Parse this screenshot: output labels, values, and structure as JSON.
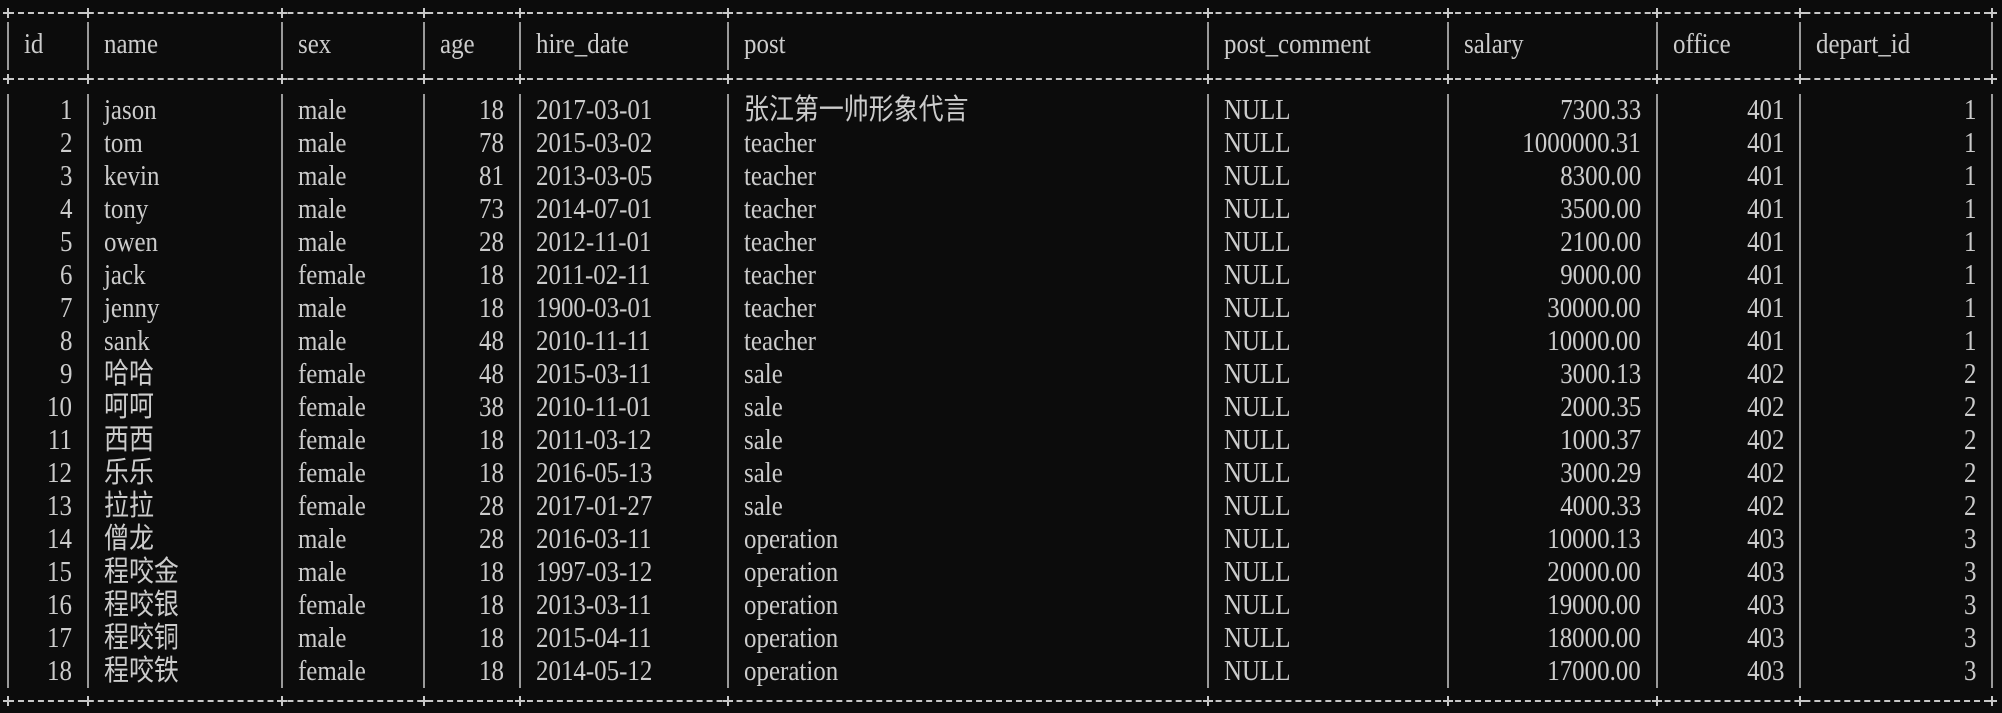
{
  "columns": [
    {
      "key": "id",
      "label": "id"
    },
    {
      "key": "name",
      "label": "name"
    },
    {
      "key": "sex",
      "label": "sex"
    },
    {
      "key": "age",
      "label": "age"
    },
    {
      "key": "hire_date",
      "label": "hire_date"
    },
    {
      "key": "post",
      "label": "post"
    },
    {
      "key": "post_comment",
      "label": "post_comment"
    },
    {
      "key": "salary",
      "label": "salary"
    },
    {
      "key": "office",
      "label": "office"
    },
    {
      "key": "depart_id",
      "label": "depart_id"
    }
  ],
  "rows": [
    {
      "id": "1",
      "name": "jason",
      "sex": "male",
      "age": "18",
      "hire_date": "2017-03-01",
      "post": "张江第一帅形象代言",
      "post_comment": "NULL",
      "salary": "7300.33",
      "office": "401",
      "depart_id": "1"
    },
    {
      "id": "2",
      "name": "tom",
      "sex": "male",
      "age": "78",
      "hire_date": "2015-03-02",
      "post": "teacher",
      "post_comment": "NULL",
      "salary": "1000000.31",
      "office": "401",
      "depart_id": "1"
    },
    {
      "id": "3",
      "name": "kevin",
      "sex": "male",
      "age": "81",
      "hire_date": "2013-03-05",
      "post": "teacher",
      "post_comment": "NULL",
      "salary": "8300.00",
      "office": "401",
      "depart_id": "1"
    },
    {
      "id": "4",
      "name": "tony",
      "sex": "male",
      "age": "73",
      "hire_date": "2014-07-01",
      "post": "teacher",
      "post_comment": "NULL",
      "salary": "3500.00",
      "office": "401",
      "depart_id": "1"
    },
    {
      "id": "5",
      "name": "owen",
      "sex": "male",
      "age": "28",
      "hire_date": "2012-11-01",
      "post": "teacher",
      "post_comment": "NULL",
      "salary": "2100.00",
      "office": "401",
      "depart_id": "1"
    },
    {
      "id": "6",
      "name": "jack",
      "sex": "female",
      "age": "18",
      "hire_date": "2011-02-11",
      "post": "teacher",
      "post_comment": "NULL",
      "salary": "9000.00",
      "office": "401",
      "depart_id": "1"
    },
    {
      "id": "7",
      "name": "jenny",
      "sex": "male",
      "age": "18",
      "hire_date": "1900-03-01",
      "post": "teacher",
      "post_comment": "NULL",
      "salary": "30000.00",
      "office": "401",
      "depart_id": "1"
    },
    {
      "id": "8",
      "name": "sank",
      "sex": "male",
      "age": "48",
      "hire_date": "2010-11-11",
      "post": "teacher",
      "post_comment": "NULL",
      "salary": "10000.00",
      "office": "401",
      "depart_id": "1"
    },
    {
      "id": "9",
      "name": "哈哈",
      "sex": "female",
      "age": "48",
      "hire_date": "2015-03-11",
      "post": "sale",
      "post_comment": "NULL",
      "salary": "3000.13",
      "office": "402",
      "depart_id": "2"
    },
    {
      "id": "10",
      "name": "呵呵",
      "sex": "female",
      "age": "38",
      "hire_date": "2010-11-01",
      "post": "sale",
      "post_comment": "NULL",
      "salary": "2000.35",
      "office": "402",
      "depart_id": "2"
    },
    {
      "id": "11",
      "name": "西西",
      "sex": "female",
      "age": "18",
      "hire_date": "2011-03-12",
      "post": "sale",
      "post_comment": "NULL",
      "salary": "1000.37",
      "office": "402",
      "depart_id": "2"
    },
    {
      "id": "12",
      "name": "乐乐",
      "sex": "female",
      "age": "18",
      "hire_date": "2016-05-13",
      "post": "sale",
      "post_comment": "NULL",
      "salary": "3000.29",
      "office": "402",
      "depart_id": "2"
    },
    {
      "id": "13",
      "name": "拉拉",
      "sex": "female",
      "age": "28",
      "hire_date": "2017-01-27",
      "post": "sale",
      "post_comment": "NULL",
      "salary": "4000.33",
      "office": "402",
      "depart_id": "2"
    },
    {
      "id": "14",
      "name": "僧龙",
      "sex": "male",
      "age": "28",
      "hire_date": "2016-03-11",
      "post": "operation",
      "post_comment": "NULL",
      "salary": "10000.13",
      "office": "403",
      "depart_id": "3"
    },
    {
      "id": "15",
      "name": "程咬金",
      "sex": "male",
      "age": "18",
      "hire_date": "1997-03-12",
      "post": "operation",
      "post_comment": "NULL",
      "salary": "20000.00",
      "office": "403",
      "depart_id": "3"
    },
    {
      "id": "16",
      "name": "程咬银",
      "sex": "female",
      "age": "18",
      "hire_date": "2013-03-11",
      "post": "operation",
      "post_comment": "NULL",
      "salary": "19000.00",
      "office": "403",
      "depart_id": "3"
    },
    {
      "id": "17",
      "name": "程咬铜",
      "sex": "male",
      "age": "18",
      "hire_date": "2015-04-11",
      "post": "operation",
      "post_comment": "NULL",
      "salary": "18000.00",
      "office": "403",
      "depart_id": "3"
    },
    {
      "id": "18",
      "name": "程咬铁",
      "sex": "female",
      "age": "18",
      "hire_date": "2014-05-12",
      "post": "operation",
      "post_comment": "NULL",
      "salary": "17000.00",
      "office": "403",
      "depart_id": "3"
    }
  ]
}
